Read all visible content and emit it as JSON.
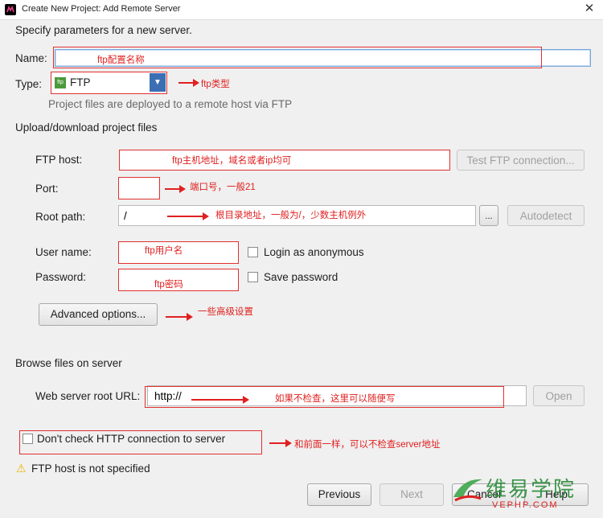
{
  "window": {
    "title": "Create New Project: Add Remote Server",
    "close_glyph": "✕"
  },
  "header": {
    "description": "Specify parameters for a new server."
  },
  "name": {
    "label": "Name:",
    "value": "",
    "annotation": "ftp配置名称"
  },
  "type": {
    "label": "Type:",
    "selected": "FTP",
    "icon_text": "ftp",
    "dropdown_glyph": "▼",
    "hint": "Project files are deployed to a remote host via FTP",
    "annotation": "ftp类型"
  },
  "upload": {
    "section_title": "Upload/download project files",
    "ftp_host": {
      "label": "FTP host:",
      "value": "",
      "annotation": "ftp主机地址，域名或者ip均可",
      "test_button": "Test FTP connection..."
    },
    "port": {
      "label": "Port:",
      "value": "",
      "annotation": "端口号，一般21"
    },
    "root_path": {
      "label": "Root path:",
      "value": "/",
      "annotation": "根目录地址，一般为/，少数主机例外",
      "browse_button": "...",
      "autodetect_button": "Autodetect"
    },
    "user_name": {
      "label": "User name:",
      "value": "",
      "annotation": "ftp用户名",
      "anonymous_label": "Login as anonymous"
    },
    "password": {
      "label": "Password:",
      "value": "",
      "annotation": "ftp密码",
      "save_label": "Save password"
    },
    "advanced": {
      "button": "Advanced options...",
      "annotation": "一些高级设置"
    }
  },
  "browse": {
    "section_title": "Browse files on server",
    "web_root": {
      "label": "Web server root URL:",
      "value": "http://",
      "annotation": "如果不检查，这里可以随便写",
      "open_button": "Open"
    }
  },
  "http_check": {
    "label": "Don't check HTTP connection to server",
    "annotation": "和前面一样，可以不检查server地址"
  },
  "warning": {
    "icon": "⚠",
    "text": "FTP host is not specified"
  },
  "footer": {
    "previous": "Previous",
    "next": "Next",
    "cancel": "Cancel",
    "help": "Help"
  },
  "watermark": {
    "cn": "维易学院",
    "en": "VEPHP.COM"
  },
  "colors": {
    "annotation_red": "#e02020",
    "accent_blue": "#3c6eb4",
    "warning_yellow": "#f0b400",
    "ftp_icon_green": "#4c9a3c"
  }
}
